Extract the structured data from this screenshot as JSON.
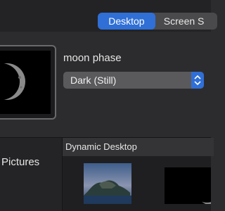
{
  "tabs": [
    {
      "label": "Desktop",
      "active": true
    },
    {
      "label": "Screen S",
      "active": false
    }
  ],
  "selected_thumbnail": {
    "icon": "moon-icon"
  },
  "selected_caption": "moon phase",
  "mode_popup": {
    "value": "Dark (Still)"
  },
  "sidebar": {
    "items": [
      {
        "label": "Pictures"
      }
    ]
  },
  "section": {
    "title": "Dynamic Desktop"
  },
  "wallpapers": [
    {
      "icon": "catalina-island-icon"
    },
    {
      "icon": "moon-icon"
    }
  ],
  "colors": {
    "accent": "#2f6fd6",
    "background": "#2c2c2e"
  }
}
